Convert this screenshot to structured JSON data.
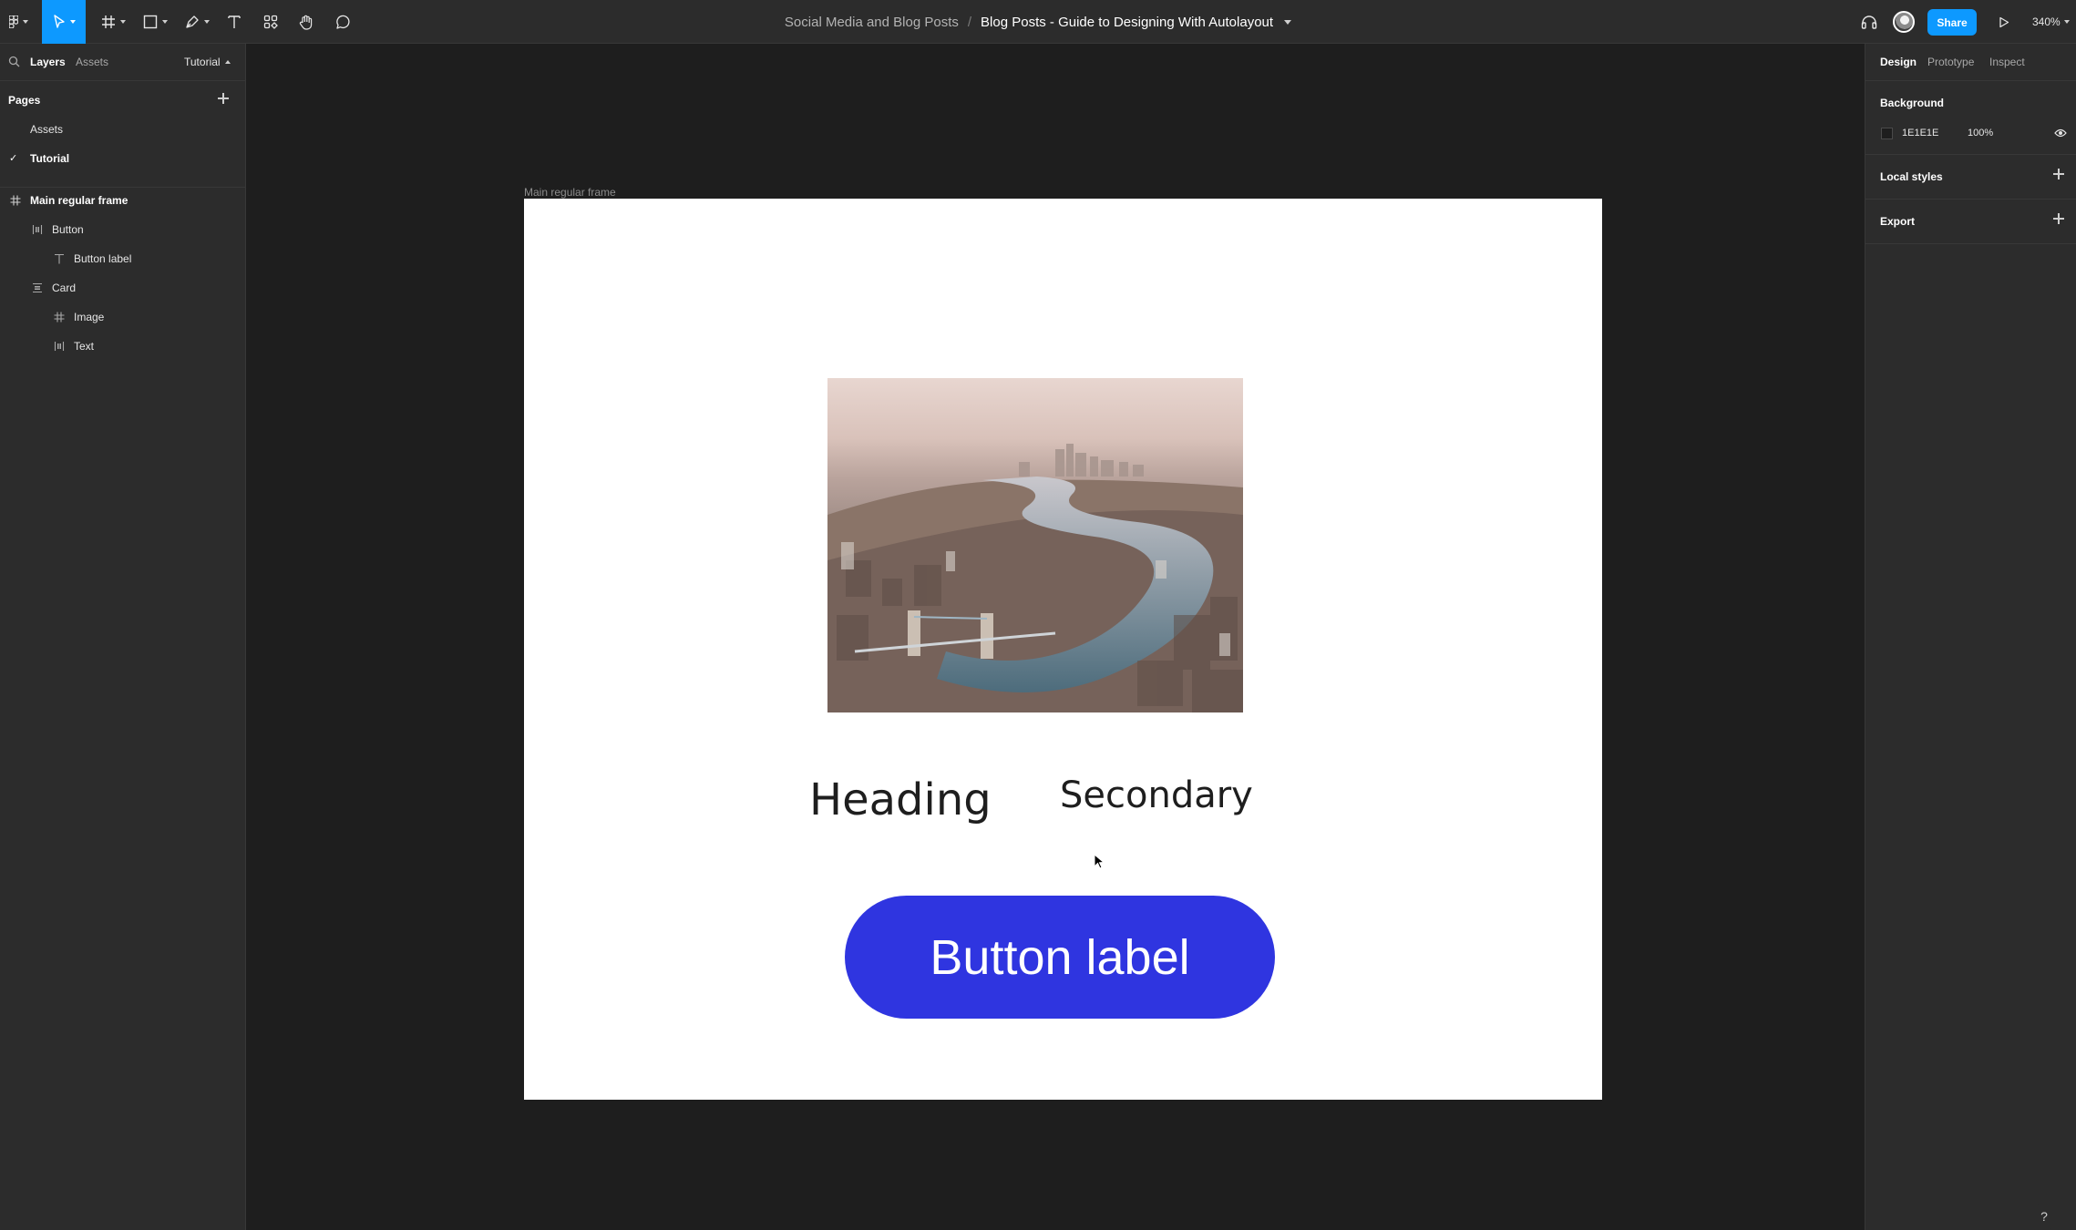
{
  "toolbar": {
    "project": "Social Media and Blog Posts",
    "separator": "/",
    "file": "Blog Posts - Guide to Designing With Autolayout",
    "share_label": "Share",
    "zoom": "340%"
  },
  "left_panel": {
    "tabs": {
      "layers": "Layers",
      "assets": "Assets"
    },
    "page_switch": "Tutorial",
    "pages_header": "Pages",
    "pages": [
      {
        "label": "Assets"
      },
      {
        "label": "Tutorial"
      }
    ],
    "layers": [
      {
        "label": "Main regular frame",
        "icon": "frame-icon"
      },
      {
        "label": "Button",
        "icon": "autolayout-horizontal-icon"
      },
      {
        "label": "Button label",
        "icon": "text-icon"
      },
      {
        "label": "Card",
        "icon": "autolayout-vertical-icon"
      },
      {
        "label": "Image",
        "icon": "frame-icon"
      },
      {
        "label": "Text",
        "icon": "autolayout-horizontal-icon"
      }
    ]
  },
  "canvas": {
    "frame_label": "Main regular frame",
    "heading": "Heading",
    "secondary": "Secondary",
    "button_label": "Button label",
    "button_color": "#2f35e0"
  },
  "right_panel": {
    "tabs": {
      "design": "Design",
      "prototype": "Prototype",
      "inspect": "Inspect"
    },
    "background_header": "Background",
    "background_hex": "1E1E1E",
    "background_opacity": "100%",
    "local_styles": "Local styles",
    "export": "Export"
  },
  "help": "?"
}
